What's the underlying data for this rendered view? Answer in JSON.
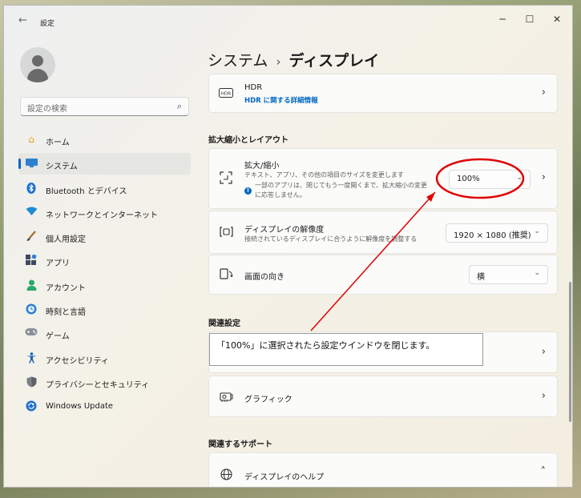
{
  "titlebar": {
    "app_title": "設定",
    "back": "←",
    "minimize": "─",
    "maximize": "☐",
    "close": "✕"
  },
  "sidebar": {
    "search_placeholder": "設定の検索",
    "items": [
      {
        "label": "ホーム",
        "icon": "home-icon"
      },
      {
        "label": "システム",
        "icon": "system-icon",
        "active": true
      },
      {
        "label": "Bluetooth とデバイス",
        "icon": "bluetooth-icon"
      },
      {
        "label": "ネットワークとインターネット",
        "icon": "network-icon"
      },
      {
        "label": "個人用設定",
        "icon": "brush-icon"
      },
      {
        "label": "アプリ",
        "icon": "apps-icon"
      },
      {
        "label": "アカウント",
        "icon": "account-icon"
      },
      {
        "label": "時刻と言語",
        "icon": "clock-icon"
      },
      {
        "label": "ゲーム",
        "icon": "gamepad-icon"
      },
      {
        "label": "アクセシビリティ",
        "icon": "accessibility-icon"
      },
      {
        "label": "プライバシーとセキュリティ",
        "icon": "shield-icon"
      },
      {
        "label": "Windows Update",
        "icon": "update-icon"
      }
    ]
  },
  "breadcrumb": {
    "parent": "システム",
    "separator": "›",
    "current": "ディスプレイ"
  },
  "hdr": {
    "title": "HDR",
    "link": "HDR に関する詳細情報",
    "icon_text": "HDR"
  },
  "scale_layout": {
    "heading": "拡大縮小とレイアウト",
    "scale": {
      "title": "拡大/縮小",
      "description": "テキスト、アプリ、その他の項目のサイズを変更します",
      "note_line1": "一部のアプリは、閉じてもう一度開くまで、拡大縮小の変更",
      "note_line2": "に応答しません。",
      "value": "100%"
    },
    "resolution": {
      "title": "ディスプレイの解像度",
      "description": "接続されているディスプレイに合うように解像度を調整する",
      "value": "1920 × 1080 (推奨)"
    },
    "orientation": {
      "title": "画面の向き",
      "value": "横"
    }
  },
  "related_settings": {
    "heading": "関連設定",
    "graphics": "グラフィック"
  },
  "related_support": {
    "heading": "関連するサポート",
    "display_help": "ディスプレイのヘルプ"
  },
  "annotation": {
    "text": "「100%」に選択されたら設定ウインドウを閉じます。",
    "color": "#e00000"
  },
  "colors": {
    "accent": "#0067c0"
  }
}
